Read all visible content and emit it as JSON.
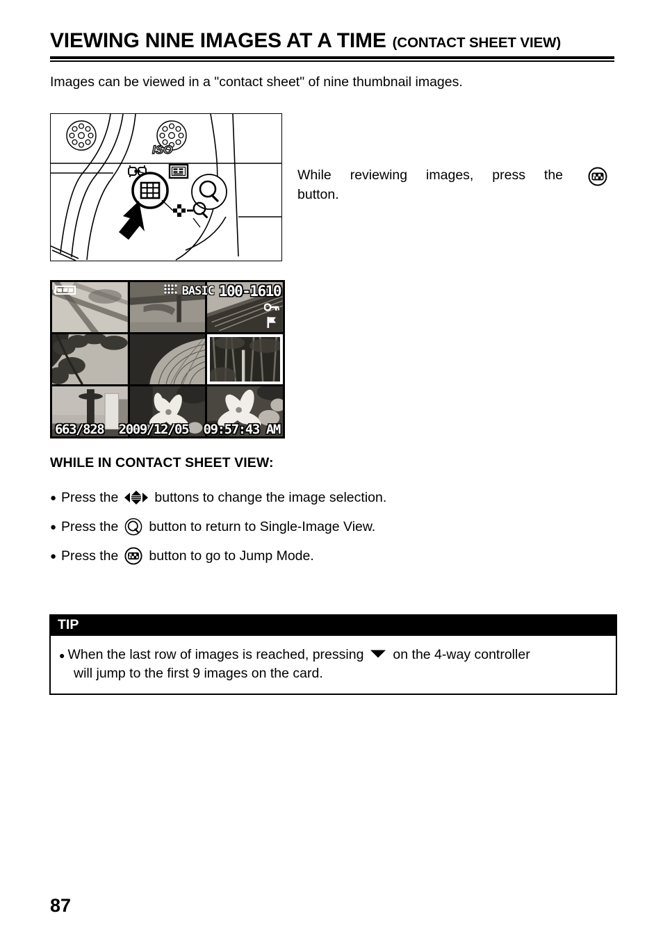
{
  "page": {
    "number": "87"
  },
  "header": {
    "title_main": "VIEWING NINE IMAGES AT A TIME",
    "title_sub": "(CONTACT SHEET VIEW)"
  },
  "intro": {
    "text": "Images can be viewed in a \"contact sheet\" of nine thumbnail images."
  },
  "camera_figure": {
    "iso_label": "ISO",
    "icons": {
      "grid_button": "grid-button-icon",
      "magnifier_button": "magnifier-button-icon",
      "checker_magnifier_label": "checkerboard-minus-magnifier-icon",
      "link_label": "link-icon",
      "display_label": "display-info-icon",
      "pointer": "arrow-pointer-icon"
    }
  },
  "lcd": {
    "battery": "battery-icon",
    "quality": "BASIC",
    "quality_icon": "image-quality-icon",
    "folder_file": "100-1610",
    "protect_icon": "key-protect-icon",
    "print_icon": "flag-print-mark-icon",
    "counter": "663/828",
    "date": "2009/12/05",
    "time": "09:57:43 AM",
    "thumbnails": [
      {
        "caption": "branches-on-sand",
        "selected": false
      },
      {
        "caption": "wooden-bench-path",
        "selected": false
      },
      {
        "caption": "roof-ridge-lines",
        "selected": false
      },
      {
        "caption": "tree-canopy-sky",
        "selected": false
      },
      {
        "caption": "woven-fan-spiral",
        "selected": false
      },
      {
        "caption": "bamboo-forest",
        "selected": true
      },
      {
        "caption": "city-tower-skyline",
        "selected": false
      },
      {
        "caption": "white-lily-flowers",
        "selected": false
      },
      {
        "caption": "lily-close-up",
        "selected": false
      }
    ]
  },
  "side_caption": {
    "line1_words": [
      "While",
      "reviewing",
      "images,",
      "press",
      "the"
    ],
    "icon": "contact-sheet-button-icon",
    "line2": "button."
  },
  "section": {
    "heading": "WHILE IN CONTACT SHEET VIEW:"
  },
  "bullets": [
    {
      "bullet": "●",
      "pre": "Press the",
      "icon": "four-way-controller-icon",
      "post": "buttons to change the image selection."
    },
    {
      "bullet": "●",
      "pre": "Press the",
      "icon": "magnifier-q-button-icon",
      "post": "button to return to Single-Image View."
    },
    {
      "bullet": "●",
      "pre": "Press the",
      "icon": "contact-sheet-button-icon",
      "post": "button to go to Jump Mode."
    }
  ],
  "tip": {
    "header": "TIP",
    "bullet": "●",
    "line1_pre": "When the last row of images is reached, pressing",
    "line1_icon": "down-arrow-icon",
    "line1_post": "on the 4-way controller",
    "line2": "will jump to the first 9 images on the card."
  },
  "colors": {
    "ink": "#000000",
    "paper": "#ffffff",
    "osd_text": "#ffffff",
    "tip_header_bg": "#000000"
  }
}
